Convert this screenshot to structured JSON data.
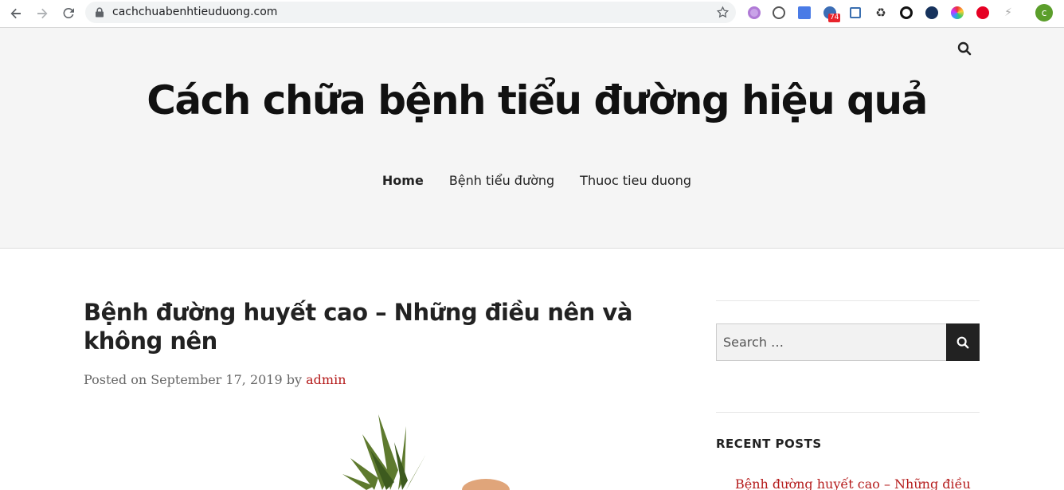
{
  "browser": {
    "url": "cachchuabenhtieuduong.com",
    "extension_badge": "74",
    "profile_initial": "c"
  },
  "site": {
    "title": "Cách chữa bệnh tiểu đường hiệu quả",
    "nav": [
      "Home",
      "Bệnh tiểu đường",
      "Thuoc tieu duong"
    ]
  },
  "post": {
    "title": "Bệnh đường huyết cao – Những điều nên và không nên",
    "meta_prefix": "Posted on",
    "date": "September 17, 2019",
    "meta_by": "by",
    "author": "admin"
  },
  "sidebar": {
    "search_placeholder": "Search …",
    "recent_title": "RECENT POSTS",
    "recent_posts": [
      "Bệnh đường huyết cao – Những điều"
    ]
  },
  "icons": {
    "back": "arrow-left-icon",
    "forward": "arrow-right-icon",
    "reload": "reload-icon",
    "lock": "lock-icon",
    "bookmark": "star-icon",
    "search": "search-icon"
  },
  "colors": {
    "link_accent": "#b51c1c",
    "header_bg": "#f5f5f5",
    "search_button": "#222222"
  }
}
